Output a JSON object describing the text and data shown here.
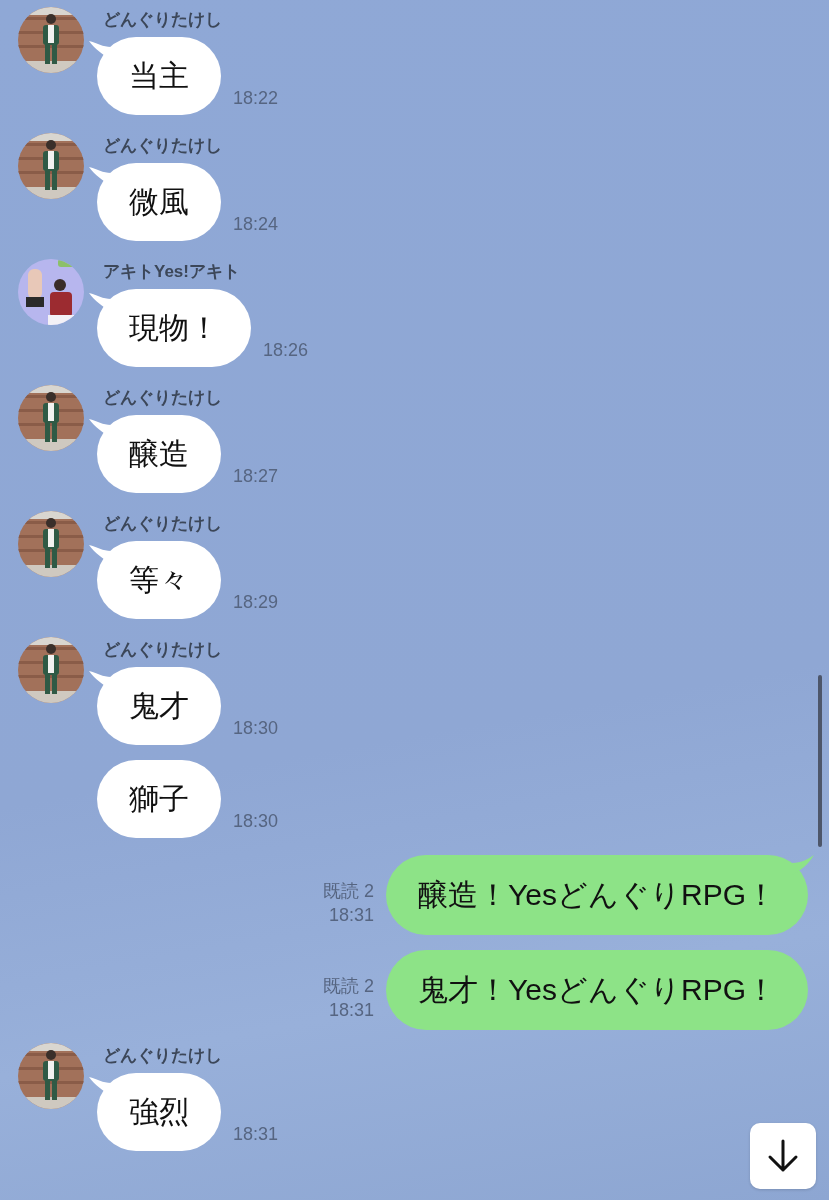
{
  "messages": [
    {
      "kind": "incoming",
      "sender": "どんぐりたけし",
      "text": "当主",
      "time": "18:22"
    },
    {
      "kind": "incoming",
      "sender": "どんぐりたけし",
      "text": "微風",
      "time": "18:24"
    },
    {
      "kind": "incoming",
      "sender": "アキトYes!アキト",
      "text": "現物！",
      "time": "18:26"
    },
    {
      "kind": "incoming",
      "sender": "どんぐりたけし",
      "text": "醸造",
      "time": "18:27"
    },
    {
      "kind": "incoming",
      "sender": "どんぐりたけし",
      "text": "等々",
      "time": "18:29"
    },
    {
      "kind": "incoming",
      "sender": "どんぐりたけし",
      "text": "鬼才",
      "time": "18:30"
    },
    {
      "kind": "incoming_more",
      "text": "獅子",
      "time": "18:30"
    },
    {
      "kind": "outgoing",
      "read": "既読 2",
      "text": "醸造！YesどんぐりRPG！",
      "time": "18:31",
      "tail": true
    },
    {
      "kind": "outgoing",
      "read": "既読 2",
      "text": "鬼才！YesどんぐりRPG！",
      "time": "18:31",
      "tail": false
    },
    {
      "kind": "incoming",
      "sender": "どんぐりたけし",
      "text": "強烈",
      "time": "18:31"
    }
  ]
}
